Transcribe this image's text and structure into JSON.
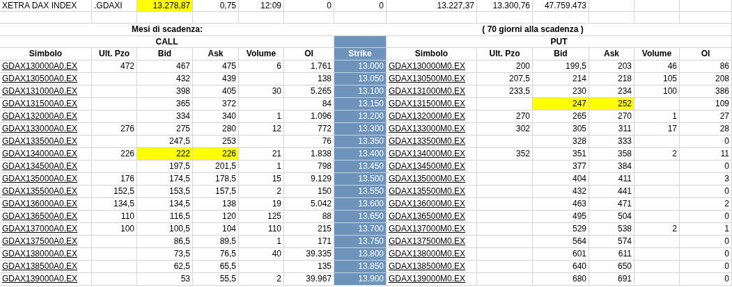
{
  "index_row": {
    "name": "XETRA DAX INDEX",
    "symbol": ".GDAXI",
    "value": "13.278,87",
    "value_highlighted": true,
    "change": "0,75",
    "time": "12:09",
    "column_6": "0",
    "column_7": "0",
    "column_8": "13.227,37",
    "column_9": "13.300,76",
    "column_10": "47.759.473"
  },
  "expiry_label": "Mesi di scadenza:",
  "days_label": "( 70 giorni alla scadenza )",
  "call_title": "CALL",
  "put_title": "PUT",
  "call_columns": [
    "Simbolo",
    "Ult. Pzo",
    "Bid",
    "Ask",
    "Volume",
    "OI"
  ],
  "strike_column": "Strike",
  "put_columns": [
    "Simbolo",
    "Ult. Pzo",
    "Bid",
    "Ask",
    "Volume",
    "OI"
  ],
  "rows": [
    {
      "strike": "13.000",
      "call": {
        "symbol": "GDAX130000A0.EX",
        "last": "472",
        "bid": "467",
        "ask": "475",
        "volume": "6",
        "oi": "1.761",
        "quote_highlighted": false
      },
      "put": {
        "symbol": "GDAX130000M0.EX",
        "last": "200",
        "bid": "199,5",
        "ask": "203",
        "volume": "46",
        "oi": "86",
        "quote_highlighted": false
      }
    },
    {
      "strike": "13.050",
      "call": {
        "symbol": "GDAX130500A0.EX",
        "bid": "432",
        "ask": "439",
        "oi": "138",
        "quote_highlighted": false
      },
      "put": {
        "symbol": "GDAX130500M0.EX",
        "last": "207,5",
        "bid": "214",
        "ask": "218",
        "volume": "105",
        "oi": "208",
        "quote_highlighted": false
      }
    },
    {
      "strike": "13.100",
      "call": {
        "symbol": "GDAX131000A0.EX",
        "bid": "398",
        "ask": "405",
        "volume": "30",
        "oi": "5.265",
        "quote_highlighted": false
      },
      "put": {
        "symbol": "GDAX131000M0.EX",
        "last": "233,5",
        "bid": "230",
        "ask": "234",
        "volume": "100",
        "oi": "386",
        "quote_highlighted": false
      }
    },
    {
      "strike": "13.150",
      "call": {
        "symbol": "GDAX131500A0.EX",
        "bid": "365",
        "ask": "372",
        "oi": "84",
        "quote_highlighted": false
      },
      "put": {
        "symbol": "GDAX131500M0.EX",
        "bid": "247",
        "ask": "252",
        "oi": "109",
        "quote_highlighted": true
      }
    },
    {
      "strike": "13.200",
      "call": {
        "symbol": "GDAX132000A0.EX",
        "bid": "334",
        "ask": "340",
        "volume": "1",
        "oi": "1.096",
        "quote_highlighted": false
      },
      "put": {
        "symbol": "GDAX132000M0.EX",
        "last": "270",
        "bid": "265",
        "ask": "270",
        "volume": "1",
        "oi": "27",
        "quote_highlighted": false
      }
    },
    {
      "strike": "13.300",
      "call": {
        "symbol": "GDAX133000A0.EX",
        "last": "276",
        "bid": "275",
        "ask": "280",
        "volume": "12",
        "oi": "772",
        "quote_highlighted": false
      },
      "put": {
        "symbol": "GDAX133000M0.EX",
        "last": "302",
        "bid": "305",
        "ask": "311",
        "volume": "17",
        "oi": "28",
        "quote_highlighted": false
      }
    },
    {
      "strike": "13.350",
      "call": {
        "symbol": "GDAX133500A0.EX",
        "bid": "247,5",
        "ask": "253",
        "oi": "76",
        "quote_highlighted": false
      },
      "put": {
        "symbol": "GDAX133500M0.EX",
        "bid": "328",
        "ask": "333",
        "oi": "0",
        "quote_highlighted": false
      }
    },
    {
      "strike": "13.400",
      "call": {
        "symbol": "GDAX134000A0.EX",
        "last": "226",
        "bid": "222",
        "ask": "226",
        "volume": "21",
        "oi": "1.838",
        "quote_highlighted": true
      },
      "put": {
        "symbol": "GDAX134000M0.EX",
        "last": "352",
        "bid": "351",
        "ask": "358",
        "volume": "2",
        "oi": "11",
        "quote_highlighted": false
      }
    },
    {
      "strike": "13.450",
      "call": {
        "symbol": "GDAX134500A0.EX",
        "bid": "197,5",
        "ask": "201,5",
        "volume": "1",
        "oi": "798",
        "quote_highlighted": false
      },
      "put": {
        "symbol": "GDAX134500M0.EX",
        "bid": "377",
        "ask": "384",
        "oi": "0",
        "quote_highlighted": false
      }
    },
    {
      "strike": "13.500",
      "call": {
        "symbol": "GDAX135000A0.EX",
        "last": "176",
        "bid": "174,5",
        "ask": "178,5",
        "volume": "15",
        "oi": "9.129",
        "quote_highlighted": false
      },
      "put": {
        "symbol": "GDAX135000M0.EX",
        "bid": "404",
        "ask": "411",
        "oi": "3",
        "quote_highlighted": false
      }
    },
    {
      "strike": "13.550",
      "call": {
        "symbol": "GDAX135500A0.EX",
        "last": "152,5",
        "bid": "153,5",
        "ask": "157,5",
        "volume": "2",
        "oi": "150",
        "quote_highlighted": false
      },
      "put": {
        "symbol": "GDAX135500M0.EX",
        "bid": "432",
        "ask": "441",
        "oi": "0",
        "quote_highlighted": false
      }
    },
    {
      "strike": "13.600",
      "call": {
        "symbol": "GDAX136000A0.EX",
        "last": "134,5",
        "bid": "134,5",
        "ask": "138",
        "volume": "19",
        "oi": "5.042",
        "quote_highlighted": false
      },
      "put": {
        "symbol": "GDAX136000M0.EX",
        "bid": "463",
        "ask": "471",
        "oi": "2",
        "quote_highlighted": false
      }
    },
    {
      "strike": "13.650",
      "call": {
        "symbol": "GDAX136500A0.EX",
        "last": "110",
        "bid": "116,5",
        "ask": "120",
        "volume": "125",
        "oi": "88",
        "quote_highlighted": false
      },
      "put": {
        "symbol": "GDAX136500M0.EX",
        "bid": "495",
        "ask": "504",
        "oi": "0",
        "quote_highlighted": false
      }
    },
    {
      "strike": "13.700",
      "call": {
        "symbol": "GDAX137000A0.EX",
        "last": "100",
        "bid": "100,5",
        "ask": "104",
        "volume": "110",
        "oi": "215",
        "quote_highlighted": false
      },
      "put": {
        "symbol": "GDAX137000M0.EX",
        "bid": "529",
        "ask": "538",
        "volume": "2",
        "oi": "1",
        "quote_highlighted": false
      }
    },
    {
      "strike": "13.750",
      "call": {
        "symbol": "GDAX137500A0.EX",
        "bid": "86,5",
        "ask": "89,5",
        "volume": "1",
        "oi": "171",
        "quote_highlighted": false
      },
      "put": {
        "symbol": "GDAX137500M0.EX",
        "bid": "564",
        "ask": "574",
        "oi": "0",
        "quote_highlighted": false
      }
    },
    {
      "strike": "13.800",
      "call": {
        "symbol": "GDAX138000A0.EX",
        "bid": "73,5",
        "ask": "76,5",
        "volume": "40",
        "oi": "39.335",
        "quote_highlighted": false
      },
      "put": {
        "symbol": "GDAX138000M0.EX",
        "bid": "601",
        "ask": "611",
        "oi": "0",
        "quote_highlighted": false
      }
    },
    {
      "strike": "13.850",
      "call": {
        "symbol": "GDAX138500A0.EX",
        "bid": "62,5",
        "ask": "65,5",
        "oi": "135",
        "quote_highlighted": false
      },
      "put": {
        "symbol": "GDAX138500M0.EX",
        "bid": "640",
        "ask": "650",
        "oi": "0",
        "quote_highlighted": false
      }
    },
    {
      "strike": "13.900",
      "call": {
        "symbol": "GDAX139000A0.EX",
        "bid": "53",
        "ask": "55,5",
        "volume": "2",
        "oi": "39.967",
        "quote_highlighted": false
      },
      "put": {
        "symbol": "GDAX139000M0.EX",
        "bid": "680",
        "ask": "691",
        "oi": "0",
        "quote_highlighted": false
      }
    }
  ]
}
